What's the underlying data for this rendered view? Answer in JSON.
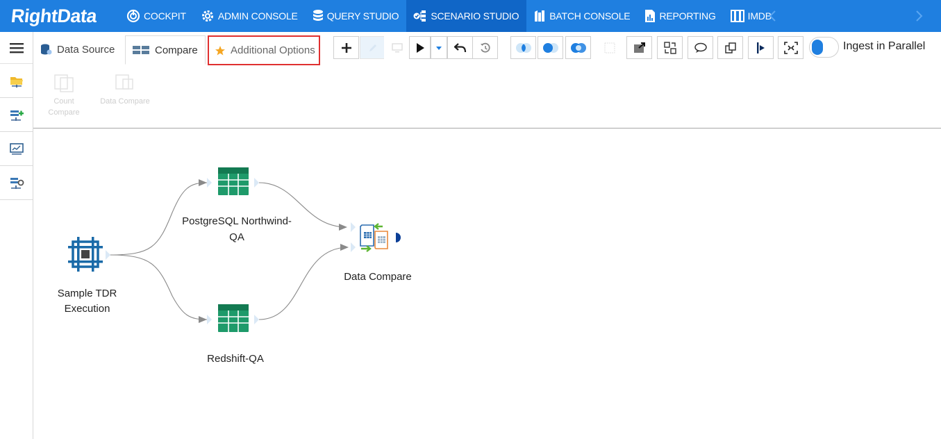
{
  "brand": {
    "logo_text": "RightData"
  },
  "nav": {
    "items": [
      {
        "label": "COCKPIT",
        "icon": "cockpit-icon"
      },
      {
        "label": "ADMIN CONSOLE",
        "icon": "gear-icon"
      },
      {
        "label": "QUERY STUDIO",
        "icon": "database-icon"
      },
      {
        "label": "SCENARIO STUDIO",
        "icon": "scenario-icon",
        "active": true
      },
      {
        "label": "BATCH CONSOLE",
        "icon": "batch-icon"
      },
      {
        "label": "REPORTING",
        "icon": "report-icon"
      },
      {
        "label": "IMDB",
        "icon": "imdb-icon"
      }
    ]
  },
  "tabs": {
    "data_source": "Data Source",
    "compare": "Compare",
    "additional_options": "Additional Options"
  },
  "toolbar": {
    "ingest_label": "Ingest in Parallel",
    "ingest_enabled": false
  },
  "subtoolbar": {
    "count_compare": "Count Compare",
    "data_compare": "Data Compare"
  },
  "canvas": {
    "nodes": {
      "source": "Sample TDR Execution",
      "table_a_line1": "PostgreSQL Northwind-",
      "table_a_line2": "QA",
      "table_b": "Redshift-QA",
      "compare": "Data Compare"
    }
  },
  "colors": {
    "nav_bg": "#1f7fe0",
    "nav_active": "#1066c7",
    "highlight_border": "#e03030",
    "table_green": "#1e9a6a",
    "source_blue": "#1a6aa8"
  }
}
